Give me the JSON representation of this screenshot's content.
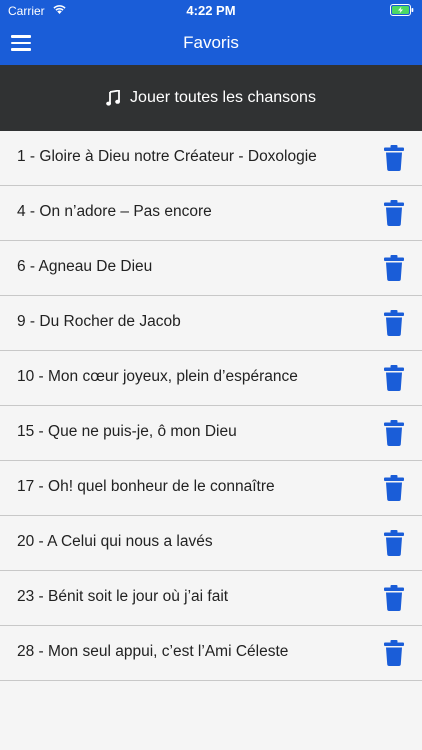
{
  "status_bar": {
    "carrier": "Carrier",
    "time": "4:22 PM"
  },
  "header": {
    "title": "Favoris",
    "menu_icon": "hamburger-menu-icon"
  },
  "play_all": {
    "label": "Jouer toutes les chansons",
    "icon": "music-note-icon"
  },
  "songs": [
    "1 - Gloire à Dieu notre Créateur - Doxologie",
    "4 - On n’adore – Pas encore",
    "6 - Agneau De Dieu",
    "9 - Du Rocher de Jacob",
    "10 - Mon cœur joyeux, plein d’espérance",
    "15 - Que ne puis-je, ô mon Dieu",
    "17 - Oh! quel bonheur de le connaître",
    "20 - A Celui qui nous a lavés",
    "23 - Bénit soit le jour où j’ai fait",
    "28 - Mon seul appui, c’est l’Ami Céleste"
  ],
  "colors": {
    "header": "#1a5dd8",
    "banner": "#303233",
    "trash": "#1a5dd8"
  }
}
